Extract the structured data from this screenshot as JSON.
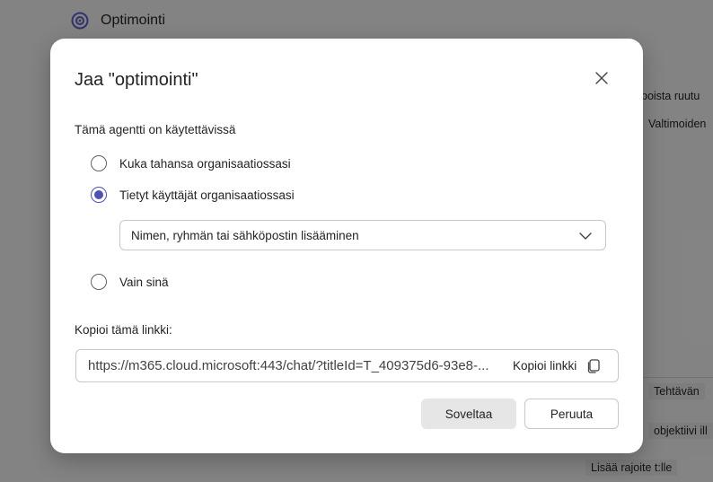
{
  "background": {
    "app_title": "Optimointi",
    "right_texts": [
      "poista ruutu",
      "Valtimoiden",
      "Tehtävän",
      "objektiivi ill",
      "Lisää rajoite t:lle"
    ]
  },
  "dialog": {
    "title": "Jaa \"optimointi\"",
    "availability_label": "Tämä agentti on käytettävissä",
    "options": [
      {
        "label": "Kuka tahansa organisaatiossasi",
        "checked": false
      },
      {
        "label": "Tietyt käyttäjät organisaatiossasi",
        "checked": true
      },
      {
        "label": "Vain sinä",
        "checked": false
      }
    ],
    "people_placeholder": "Nimen, ryhmän tai sähköpostin lisääminen",
    "link_label": "Kopioi tämä linkki:",
    "link_value": "https://m365.cloud.microsoft:443/chat/?titleId=T_409375d6-93e8-...",
    "copy_label": "Kopioi linkki",
    "apply_label": "Soveltaa",
    "cancel_label": "Peruuta"
  },
  "colors": {
    "accent": "#4f52b2",
    "scrim": "rgba(0,0,0,0.46)"
  },
  "icons": [
    "app-logo-icon",
    "close-icon",
    "chevron-down-icon",
    "copy-icon"
  ]
}
